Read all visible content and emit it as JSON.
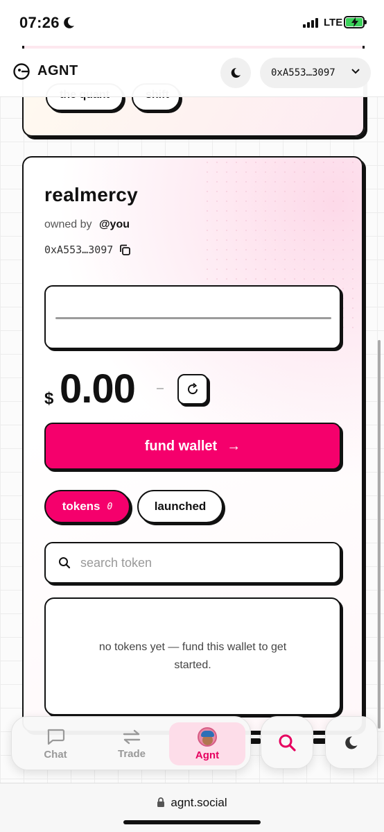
{
  "status_bar": {
    "time": "07:26",
    "network": "LTE",
    "battery_color": "#3bd25a"
  },
  "header": {
    "brand": "AGNT",
    "wallet_address": "0xA553…3097"
  },
  "prev_card": {
    "chips": [
      "the quant",
      "shift"
    ]
  },
  "wallet": {
    "name": "realmercy",
    "owned_by_label": "owned by",
    "owner": "@you",
    "address": "0xA553…3097",
    "currency_symbol": "$",
    "balance": "0.00",
    "fund_label": "fund wallet",
    "fund_arrow": "→",
    "tabs": {
      "tokens_label": "tokens",
      "tokens_count": "0",
      "launched_label": "launched"
    },
    "search_placeholder": "search token",
    "empty_message": "no tokens yet — fund this wallet to get started."
  },
  "nav": {
    "items": [
      {
        "label": "Chat",
        "icon": "chat-icon"
      },
      {
        "label": "Trade",
        "icon": "swap-icon"
      },
      {
        "label": "Agnt",
        "icon": "avatar"
      }
    ],
    "active": "Agnt"
  },
  "browser": {
    "url": "agnt.social"
  },
  "colors": {
    "accent": "#f5006c",
    "active_tab_bg": "#fddde9"
  }
}
